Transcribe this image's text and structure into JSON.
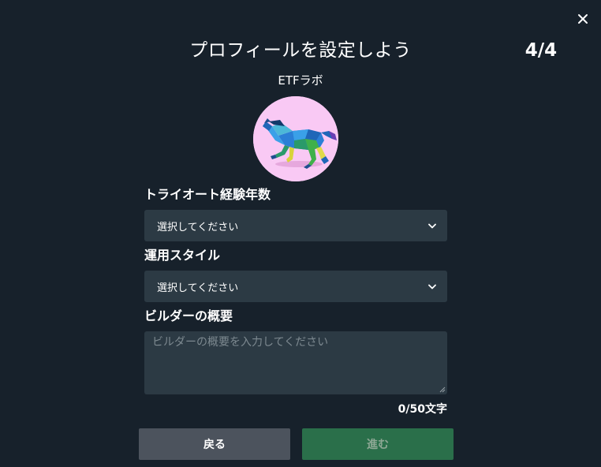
{
  "header": {
    "title": "プロフィールを設定しよう",
    "step": "4/4",
    "close_icon": "close-icon"
  },
  "profile": {
    "username": "ETFラボ",
    "avatar_icon": "horse-avatar-icon"
  },
  "fields": {
    "experience": {
      "label": "トライオート経験年数",
      "value": "選択してください"
    },
    "style": {
      "label": "運用スタイル",
      "value": "選択してください"
    },
    "summary": {
      "label": "ビルダーの概要",
      "placeholder": "ビルダーの概要を入力してください",
      "counter": "0/50文字"
    }
  },
  "buttons": {
    "back": "戻る",
    "next": "進む"
  },
  "colors": {
    "background": "#17212b",
    "input": "#2c3a44",
    "back_button": "#4c535d",
    "next_button": "#2a6f4a",
    "avatar_bg": "#f9c9f4"
  }
}
